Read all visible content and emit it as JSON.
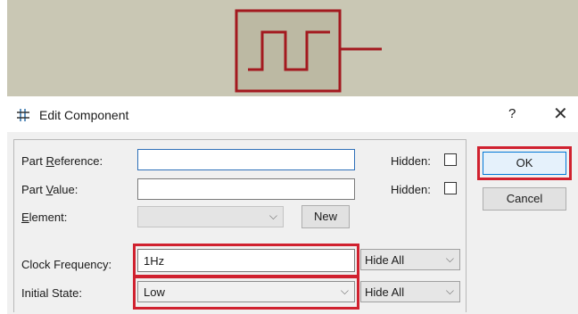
{
  "canvas": {
    "component_color": "#a3191f",
    "background": "#c9c7b4"
  },
  "dialog": {
    "title": "Edit Component",
    "help_label": "?",
    "close_label": "✕"
  },
  "fields": {
    "part_reference": {
      "label_pre": "Part ",
      "label_acc": "R",
      "label_post": "eference:",
      "value": "",
      "hidden_label": "Hidden:",
      "hidden_checked": false
    },
    "part_value": {
      "label_pre": "Part ",
      "label_acc": "V",
      "label_post": "alue:",
      "value": "",
      "hidden_label": "Hidden:",
      "hidden_checked": false
    },
    "element": {
      "label_acc": "E",
      "label_post": "lement:",
      "value": "",
      "new_label": "New"
    },
    "clock_frequency": {
      "label": "Clock Frequency:",
      "value": "1Hz",
      "visibility": "Hide All"
    },
    "initial_state": {
      "label": "Initial State:",
      "value": "Low",
      "visibility": "Hide All"
    }
  },
  "buttons": {
    "ok": "OK",
    "cancel": "Cancel"
  },
  "highlight_color": "#d0212f"
}
